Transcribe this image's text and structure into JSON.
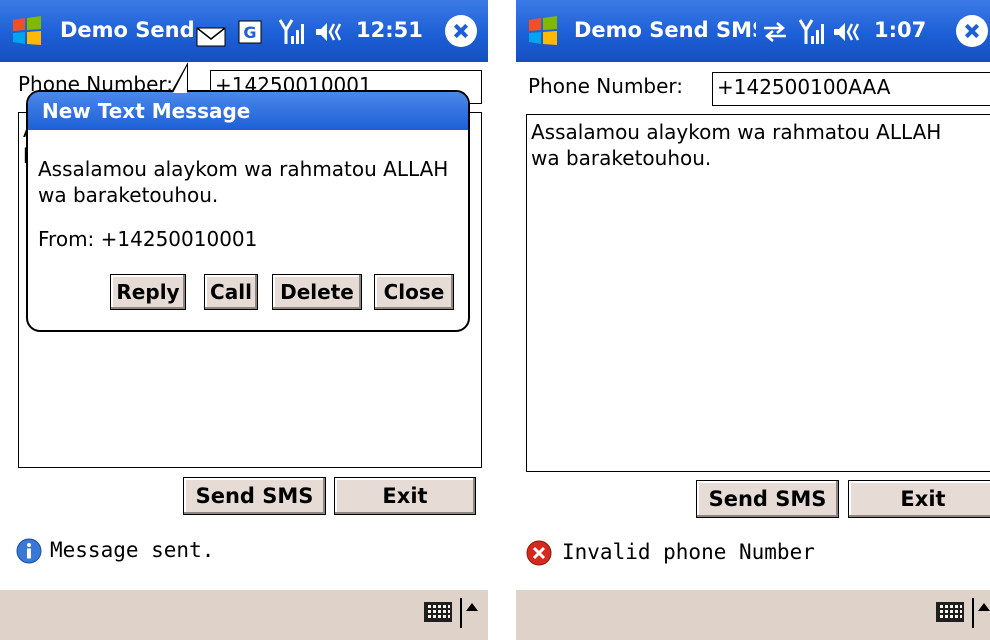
{
  "left": {
    "title": "Demo Send",
    "clock": "12:51",
    "phone_label": "Phone Number:",
    "phone_value": "+14250010001",
    "message": "Assalamou alaykom wa rahmatou ALLAH wa baraketouhou.",
    "send_label": "Send SMS",
    "exit_label": "Exit",
    "status_text": "Message sent.",
    "status_icon": "info-icon",
    "notification": {
      "title": "New Text Message",
      "body": "Assalamou alaykom wa rahmatou ALLAH wa baraketouhou.",
      "from": "From: +14250010001",
      "buttons": {
        "reply": "Reply",
        "call": "Call",
        "delete": "Delete",
        "close": "Close"
      }
    }
  },
  "right": {
    "title": "Demo Send SMS",
    "clock": "1:07",
    "phone_label": "Phone Number:",
    "phone_value": "+142500100AAA",
    "message": "Assalamou alaykom wa rahmatou ALLAH\nwa baraketouhou.",
    "send_label": "Send SMS",
    "exit_label": "Exit",
    "status_text": "Invalid phone Number",
    "status_icon": "error-icon"
  },
  "colors": {
    "title_bar": "#1d5fd6",
    "bottom_bar": "#dfd3c9",
    "button_face": "#e6dcd5",
    "error": "#d42a1e",
    "info": "#3a78d8"
  }
}
